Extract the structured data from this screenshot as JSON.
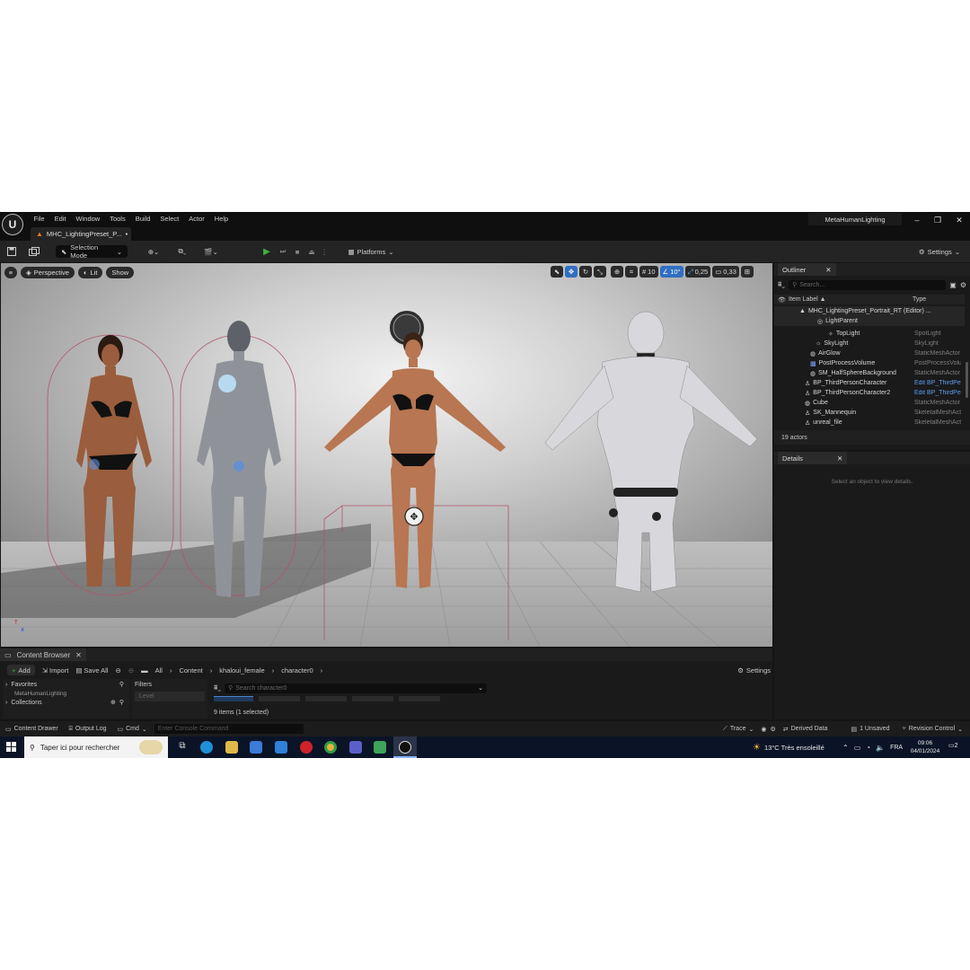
{
  "menubar": {
    "items": [
      "File",
      "Edit",
      "Window",
      "Tools",
      "Build",
      "Select",
      "Actor",
      "Help"
    ],
    "project": "MetaHumanLighting"
  },
  "level_tab": {
    "label": "MHC_LightingPreset_P...",
    "modified": "•"
  },
  "toolbar": {
    "selection_mode": "Selection Mode",
    "platforms": "Platforms",
    "settings": "Settings"
  },
  "viewport": {
    "perspective": "Perspective",
    "lit": "Lit",
    "show": "Show",
    "grid_size": "10",
    "rotation_snap": "10°",
    "scale_snap": "0,25",
    "camera_speed": "0,33"
  },
  "outliner": {
    "tab": "Outliner",
    "search_placeholder": "Search...",
    "col_label": "Item Label ▲",
    "col_type": "Type",
    "rows": [
      {
        "label": "MHC_LightingPreset_Portrait_RT (Editor) ...",
        "type": ""
      },
      {
        "label": "LightParent",
        "type": ""
      },
      {
        "label": "TopLight",
        "type": "SpotLight"
      },
      {
        "label": "SkyLight",
        "type": "SkyLight"
      },
      {
        "label": "AirGlow",
        "type": "StaticMeshActor"
      },
      {
        "label": "PostProcessVolume",
        "type": "PostProcessVolume"
      },
      {
        "label": "SM_HalfSphereBackground",
        "type": "StaticMeshActor"
      },
      {
        "label": "BP_ThirdPersonCharacter",
        "type": "Edit BP_ThirdPersonCharacter"
      },
      {
        "label": "BP_ThirdPersonCharacter2",
        "type": "Edit BP_ThirdPersonCharacter"
      },
      {
        "label": "Cube",
        "type": "StaticMeshActor"
      },
      {
        "label": "SK_Mannequin",
        "type": "SkeletalMeshActor"
      },
      {
        "label": "unreal_file",
        "type": "SkeletalMeshActor"
      }
    ],
    "actor_count": "19 actors"
  },
  "details": {
    "tab": "Details",
    "empty": "Select an object to view details."
  },
  "content_browser": {
    "tab": "Content Browser",
    "add": "Add",
    "import": "Import",
    "save_all": "Save All",
    "path": [
      "All",
      "Content",
      "khaloui_female",
      "character0"
    ],
    "settings": "Settings",
    "favorites": "Favorites",
    "folder": "MetaHumanLighting",
    "collections": "Collections",
    "filters": "Filters",
    "level_chip": "Level",
    "search_placeholder": "Search character0",
    "items_info": "9 items (1 selected)"
  },
  "statusbar": {
    "content_drawer": "Content Drawer",
    "output_log": "Output Log",
    "cmd": "Cmd",
    "console_placeholder": "Enter Console Command",
    "trace": "Trace",
    "derived_data": "Derived Data",
    "unsaved": "1 Unsaved",
    "revision_control": "Revision Control"
  },
  "taskbar": {
    "search": "Taper ici pour rechercher",
    "weather": "13°C  Très ensoleillé",
    "lang": "FRA",
    "time": "09:06",
    "date": "04/01/2024",
    "notif": "2"
  },
  "colors": {
    "accent_blue": "#2f6fc2",
    "play_green": "#3fb33f",
    "ue_orange": "#e27a1a",
    "link_blue": "#5b9cf0"
  }
}
